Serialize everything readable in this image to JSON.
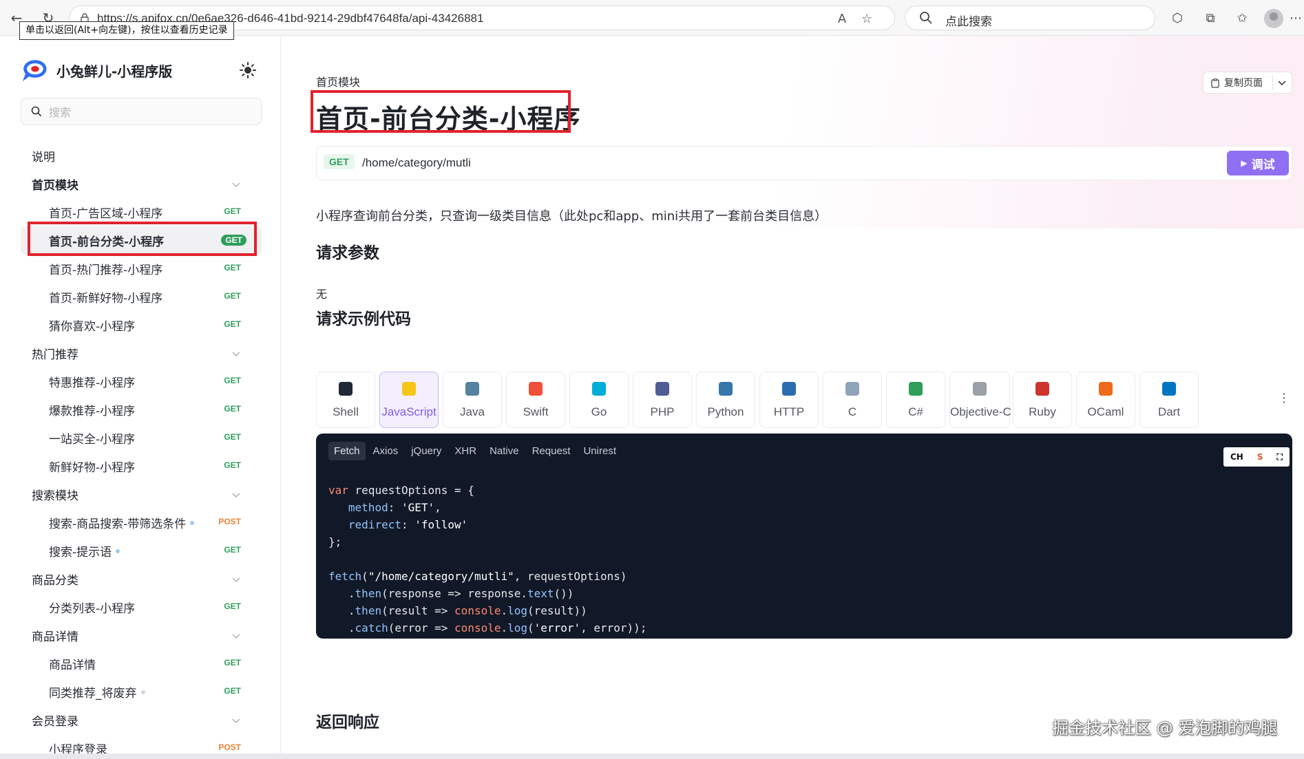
{
  "browser": {
    "url": "https://s.apifox.cn/0e6ae326-d646-41bd-9214-29dbf47648fa/api-43426881",
    "search_placeholder": "点此搜索",
    "back_tooltip": "单击以返回(Alt+向左键)，按住以查看历史记录"
  },
  "sidebar": {
    "brand": "小兔鲜儿-小程序版",
    "search_placeholder": "搜索",
    "rows": [
      {
        "type": "section",
        "label": "说明",
        "bold": false
      },
      {
        "type": "section",
        "label": "首页模块",
        "bold": true,
        "chevron": true
      },
      {
        "type": "item",
        "label": "首页-广告区域-小程序",
        "method": "GET"
      },
      {
        "type": "item",
        "label": "首页-前台分类-小程序",
        "method": "GET",
        "active": true
      },
      {
        "type": "item",
        "label": "首页-热门推荐-小程序",
        "method": "GET"
      },
      {
        "type": "item",
        "label": "首页-新鲜好物-小程序",
        "method": "GET"
      },
      {
        "type": "item",
        "label": "猜你喜欢-小程序",
        "method": "GET"
      },
      {
        "type": "section",
        "label": "热门推荐",
        "bold": false,
        "chevron": true
      },
      {
        "type": "item",
        "label": "特惠推荐-小程序",
        "method": "GET"
      },
      {
        "type": "item",
        "label": "爆款推荐-小程序",
        "method": "GET"
      },
      {
        "type": "item",
        "label": "一站买全-小程序",
        "method": "GET"
      },
      {
        "type": "item",
        "label": "新鲜好物-小程序",
        "method": "GET"
      },
      {
        "type": "section",
        "label": "搜索模块",
        "bold": false,
        "chevron": true
      },
      {
        "type": "item",
        "label": "搜索-商品搜索-带筛选条件",
        "method": "POST",
        "dot": "blue"
      },
      {
        "type": "item",
        "label": "搜索-提示语",
        "method": "GET",
        "dot": "blue"
      },
      {
        "type": "section",
        "label": "商品分类",
        "bold": false,
        "chevron": true
      },
      {
        "type": "item",
        "label": "分类列表-小程序",
        "method": "GET"
      },
      {
        "type": "section",
        "label": "商品详情",
        "bold": false,
        "chevron": true
      },
      {
        "type": "item",
        "label": "商品详情",
        "method": "GET"
      },
      {
        "type": "item",
        "label": "同类推荐_将废弃",
        "method": "GET",
        "dot": "grey"
      },
      {
        "type": "section",
        "label": "会员登录",
        "bold": false,
        "chevron": true
      },
      {
        "type": "item",
        "label": "小程序登录",
        "method": "POST"
      }
    ]
  },
  "main": {
    "breadcrumb": "首页模块",
    "title": "首页-前台分类-小程序",
    "copy_page_label": "复制页面",
    "method": "GET",
    "path": "/home/category/mutli",
    "debug_label": "调试",
    "description": "小程序查询前台分类，只查询一级类目信息（此处pc和app、mini共用了一套前台类目信息）",
    "params_heading": "请求参数",
    "params_none": "无",
    "example_heading": "请求示例代码",
    "response_heading": "返回响应",
    "languages": [
      {
        "label": "Shell",
        "icon": "terminal-icon",
        "color": "#1f2937"
      },
      {
        "label": "JavaScript",
        "icon": "js-icon",
        "color": "#f5c518",
        "active": true
      },
      {
        "label": "Java",
        "icon": "java-icon",
        "color": "#5382a1"
      },
      {
        "label": "Swift",
        "icon": "swift-icon",
        "color": "#f05138"
      },
      {
        "label": "Go",
        "icon": "go-icon",
        "color": "#00add8"
      },
      {
        "label": "PHP",
        "icon": "php-icon",
        "color": "#4f5b93"
      },
      {
        "label": "Python",
        "icon": "python-icon",
        "color": "#3776ab"
      },
      {
        "label": "HTTP",
        "icon": "http-icon",
        "color": "#2b6cb0"
      },
      {
        "label": "C",
        "icon": "c-icon",
        "color": "#8fa3b8"
      },
      {
        "label": "C#",
        "icon": "csharp-icon",
        "color": "#2e9e5b"
      },
      {
        "label": "Objective-C",
        "icon": "objc-icon",
        "color": "#9aa0a6"
      },
      {
        "label": "Ruby",
        "icon": "ruby-icon",
        "color": "#cc342d"
      },
      {
        "label": "OCaml",
        "icon": "ocaml-icon",
        "color": "#ee6a1a"
      },
      {
        "label": "Dart",
        "icon": "dart-icon",
        "color": "#0175c2"
      }
    ],
    "code_tabs": [
      "Fetch",
      "Axios",
      "jQuery",
      "XHR",
      "Native",
      "Request",
      "Unirest"
    ],
    "code_tools_label": "CH",
    "code": {
      "l1_kw": "var",
      "l1_rest": " requestOptions = {",
      "l2_prop": "method",
      "l2_rest": ": ",
      "l2_str": "'GET'",
      "l2_end": ",",
      "l3_prop": "redirect",
      "l3_rest": ": ",
      "l3_str": "'follow'",
      "l4": "};",
      "l6_fn": "fetch",
      "l6_open": "(",
      "l6_str": "\"/home/category/mutli\"",
      "l6_rest": ", requestOptions)",
      "l7_dot": ".",
      "l7_fn": "then",
      "l7_rest": "(response => response.",
      "l7_fn2": "text",
      "l7_end": "())",
      "l8_dot": ".",
      "l8_fn": "then",
      "l8_rest": "(result => ",
      "l8_glob": "console",
      "l8_dot2": ".",
      "l8_fn2": "log",
      "l8_end": "(result))",
      "l9_dot": ".",
      "l9_fn": "catch",
      "l9_rest": "(error => ",
      "l9_glob": "console",
      "l9_dot2": ".",
      "l9_fn2": "log",
      "l9_open": "(",
      "l9_str": "'error'",
      "l9_end": ", error));"
    }
  },
  "watermark": "掘金技术社区 @ 爱泡脚的鸡腿",
  "colors": {
    "accent": "#8f6ff2",
    "get": "#2e9e5b",
    "post": "#e8833a",
    "highlight": "#e0232e"
  }
}
